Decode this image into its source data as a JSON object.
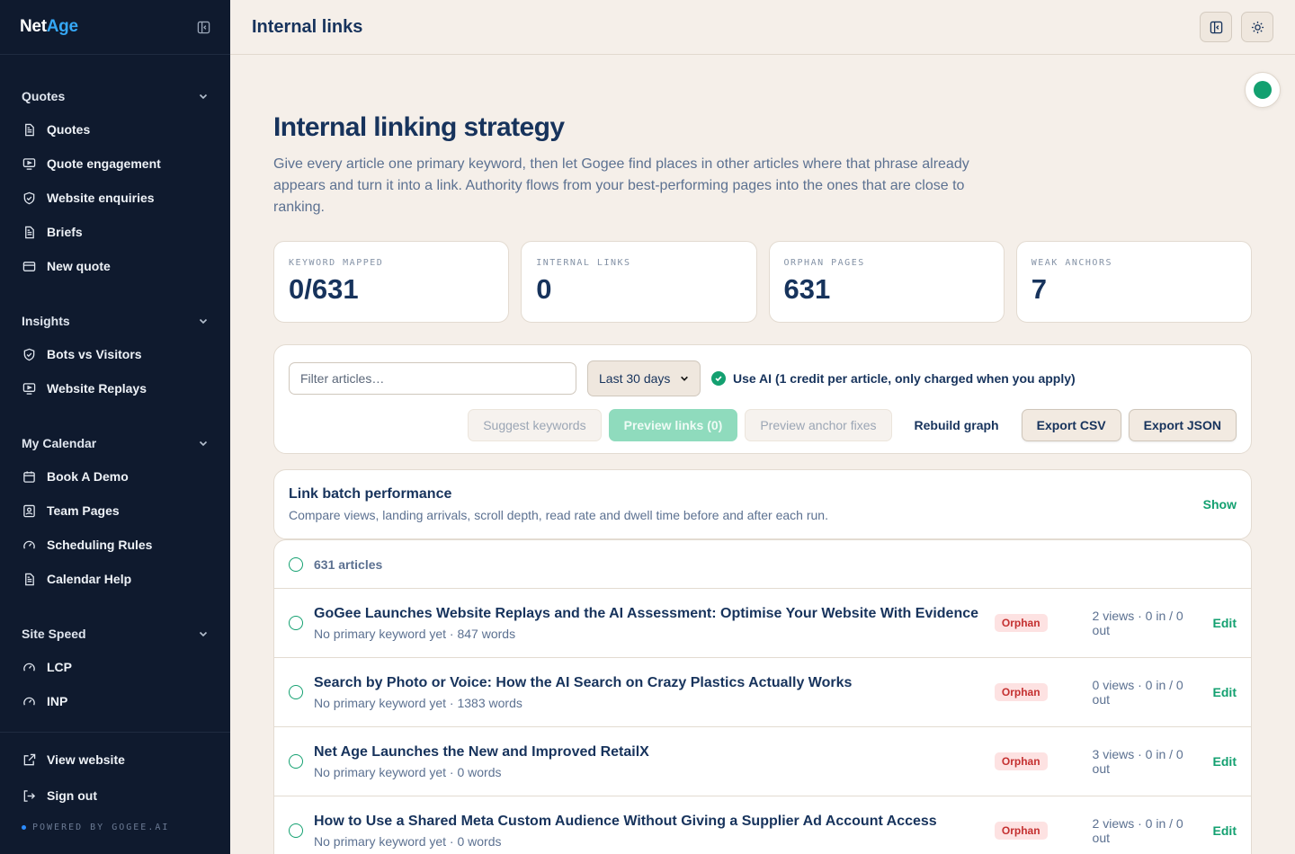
{
  "brand": {
    "part1": "Net",
    "part2": "Age"
  },
  "sidebar": {
    "sections": [
      {
        "title": "Quotes",
        "items": [
          {
            "label": "Quotes",
            "icon": "document-icon"
          },
          {
            "label": "Quote engagement",
            "icon": "monitor-icon"
          },
          {
            "label": "Website enquiries",
            "icon": "shield-icon"
          },
          {
            "label": "Briefs",
            "icon": "document-icon"
          },
          {
            "label": "New quote",
            "icon": "card-icon"
          }
        ]
      },
      {
        "title": "Insights",
        "items": [
          {
            "label": "Bots vs Visitors",
            "icon": "shield-icon"
          },
          {
            "label": "Website Replays",
            "icon": "monitor-icon"
          }
        ]
      },
      {
        "title": "My Calendar",
        "items": [
          {
            "label": "Book A Demo",
            "icon": "calendar-icon"
          },
          {
            "label": "Team Pages",
            "icon": "badge-icon"
          },
          {
            "label": "Scheduling Rules",
            "icon": "gauge-icon"
          },
          {
            "label": "Calendar Help",
            "icon": "document-icon"
          }
        ]
      },
      {
        "title": "Site Speed",
        "items": [
          {
            "label": "LCP",
            "icon": "gauge-icon"
          },
          {
            "label": "INP",
            "icon": "gauge-icon"
          }
        ]
      }
    ],
    "footer": {
      "view_website": "View website",
      "sign_out": "Sign out",
      "powered": "POWERED BY GOGEE.AI"
    }
  },
  "topbar": {
    "title": "Internal links"
  },
  "main": {
    "title": "Internal linking strategy",
    "intro": "Give every article one primary keyword, then let Gogee find places in other articles where that phrase already appears and turn it into a link. Authority flows from your best-performing pages into the ones that are close to ranking."
  },
  "stats": [
    {
      "label": "KEYWORD MAPPED",
      "value": "0/631"
    },
    {
      "label": "INTERNAL LINKS",
      "value": "0"
    },
    {
      "label": "ORPHAN PAGES",
      "value": "631"
    },
    {
      "label": "WEAK ANCHORS",
      "value": "7"
    }
  ],
  "toolbar": {
    "filter_placeholder": "Filter articles…",
    "range_value": "Last 30 days",
    "ai_label": "Use AI (1 credit per article, only charged when you apply)",
    "suggest": "Suggest keywords",
    "preview_links": "Preview links (0)",
    "preview_anchor": "Preview anchor fixes",
    "rebuild": "Rebuild graph",
    "export_csv": "Export CSV",
    "export_json": "Export JSON"
  },
  "perf": {
    "title": "Link batch performance",
    "subtitle": "Compare views, landing arrivals, scroll depth, read rate and dwell time before and after each run.",
    "show": "Show"
  },
  "list": {
    "header": "631 articles",
    "rows": [
      {
        "title": "GoGee Launches Website Replays and the AI Assessment: Optimise Your Website With Evidence",
        "meta": "No primary keyword yet · 847 words",
        "badge": "Orphan",
        "stats": "2 views · 0 in / 0 out",
        "edit": "Edit"
      },
      {
        "title": "Search by Photo or Voice: How the AI Search on Crazy Plastics Actually Works",
        "meta": "No primary keyword yet · 1383 words",
        "badge": "Orphan",
        "stats": "0 views · 0 in / 0 out",
        "edit": "Edit"
      },
      {
        "title": "Net Age Launches the New and Improved RetailX",
        "meta": "No primary keyword yet · 0 words",
        "badge": "Orphan",
        "stats": "3 views · 0 in / 0 out",
        "edit": "Edit"
      },
      {
        "title": "How to Use a Shared Meta Custom Audience Without Giving a Supplier Ad Account Access",
        "meta": "No primary keyword yet · 0 words",
        "badge": "Orphan",
        "stats": "2 views · 0 in / 0 out",
        "edit": "Edit"
      }
    ]
  },
  "colors": {
    "accent": "#13a070",
    "navy": "#17335c",
    "sidebar": "#0f1a2e",
    "orphan": "#c43030"
  }
}
